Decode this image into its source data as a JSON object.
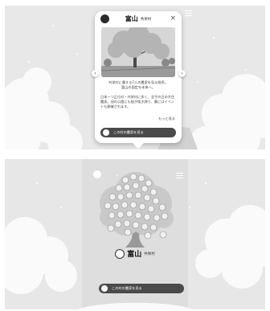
{
  "popup": {
    "village_name": "富山",
    "village_suffix": "共栄村",
    "description_1": "共栄村に属する7人の農家を見る秩序。\n富山の固定を未来へ。",
    "description_2": "日本一つ正位村・共栄村に多く、全平の日の大住農家。冠の公園にも桜が咲き誇り、春にはイベントも開催されます。",
    "more_link": "もっと見る",
    "cta_label": "この村の農家を見る"
  },
  "tree": {
    "village_name": "富山",
    "village_suffix": "共栄村",
    "cta_label": "この村の農家を見る"
  },
  "colors": {
    "background": "#e9e9e9",
    "cta": "#4a4a4a"
  }
}
